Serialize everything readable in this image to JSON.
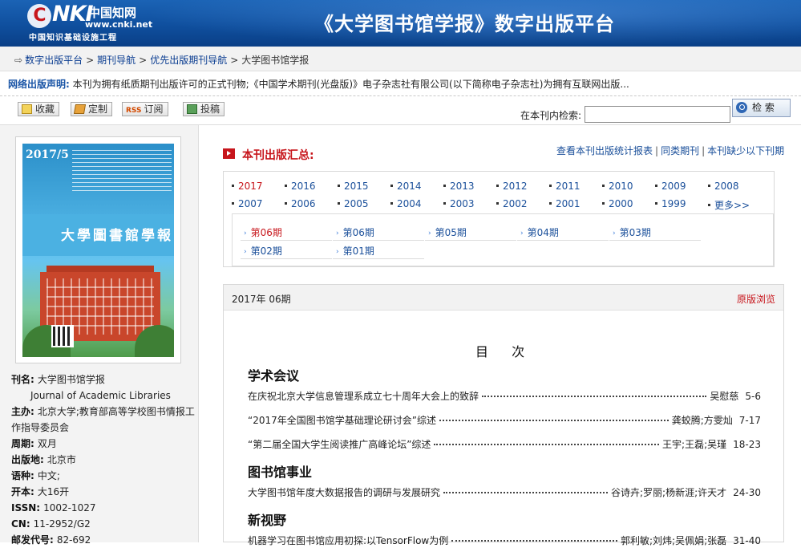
{
  "header": {
    "logo_text": "cnki",
    "logo_cn": "中国知网",
    "logo_url": "www.cnki.net",
    "logo_sub": "中国知识基础设施工程",
    "site_title": "《大学图书馆学报》数字出版平台"
  },
  "breadcrumb": [
    "数字出版平台",
    "期刊导航",
    "优先出版期刊导航",
    "大学图书馆学报"
  ],
  "notice": {
    "label": "网络出版声明:",
    "text": "本刊为拥有纸质期刊出版许可的正式刊物;《中国学术期刊(光盘版)》电子杂志社有限公司(以下简称电子杂志社)为拥有互联网出版..."
  },
  "toolbar": {
    "favorite": "收藏",
    "customize": "定制",
    "rss_badge": "RSS",
    "subscribe": "订阅",
    "submit": "投稿",
    "search_label": "在本刊内检索:",
    "search_value": "",
    "search_button": "检 索"
  },
  "cover": {
    "year": "2017/5",
    "title": "大學圖書館學報"
  },
  "info": [
    {
      "k": "刊名:",
      "v": "大学图书馆学报"
    },
    {
      "k": "",
      "v": "Journal of Academic Libraries"
    },
    {
      "k": "主办:",
      "v": "北京大学;教育部高等学校图书情报工作指导委员会"
    },
    {
      "k": "周期:",
      "v": "双月"
    },
    {
      "k": "出版地:",
      "v": "北京市"
    },
    {
      "k": "语种:",
      "v": "中文;"
    },
    {
      "k": "开本:",
      "v": "大16开"
    },
    {
      "k": "ISSN:",
      "v": "1002-1027"
    },
    {
      "k": "CN:",
      "v": "11-2952/G2"
    },
    {
      "k": "邮发代号:",
      "v": "82-692"
    }
  ],
  "summary": {
    "title": "本刊出版汇总:",
    "links": [
      "查看本刊出版统计报表",
      "同类期刊",
      "本刊缺少以下刊期"
    ]
  },
  "years": [
    "2017",
    "2016",
    "2015",
    "2014",
    "2013",
    "2012",
    "2011",
    "2010",
    "2009",
    "2008",
    "2007",
    "2006",
    "2005",
    "2004",
    "2003",
    "2002",
    "2001",
    "2000",
    "1999",
    "更多>>"
  ],
  "selected_year": "2017",
  "periods": [
    "第06期",
    "第06期",
    "第05期",
    "第04期",
    "第03期",
    "第02期",
    "第01期"
  ],
  "selected_period_index": 0,
  "toc": {
    "issue": "2017年 06期",
    "original_view": "原版浏览",
    "heading": "目 次",
    "sections": [
      {
        "title": "学术会议",
        "articles": [
          {
            "title": "在庆祝北京大学信息管理系成立七十周年大会上的致辞",
            "authors": "吴慰慈",
            "pages": "5-6"
          },
          {
            "title": "“2017年全国图书馆学基础理论研讨会”综述",
            "authors": "龚蛟腾;方雯灿",
            "pages": "7-17"
          },
          {
            "title": "“第二届全国大学生阅读推广高峰论坛”综述",
            "authors": "王宇;王磊;吴瑾",
            "pages": "18-23"
          }
        ]
      },
      {
        "title": "图书馆事业",
        "articles": [
          {
            "title": "大学图书馆年度大数据报告的调研与发展研究",
            "authors": "谷诗卉;罗丽;杨新涯;许天才",
            "pages": "24-30"
          }
        ]
      },
      {
        "title": "新视野",
        "articles": [
          {
            "title": "机器学习在图书馆应用初探:以TensorFlow为例",
            "authors": "郭利敏;刘炜;吴佩娟;张磊",
            "pages": "31-40"
          }
        ]
      }
    ]
  },
  "colors": {
    "header_blue": "#0f4f9e",
    "accent_red": "#c7161c",
    "link_blue": "#1a4f9a"
  }
}
